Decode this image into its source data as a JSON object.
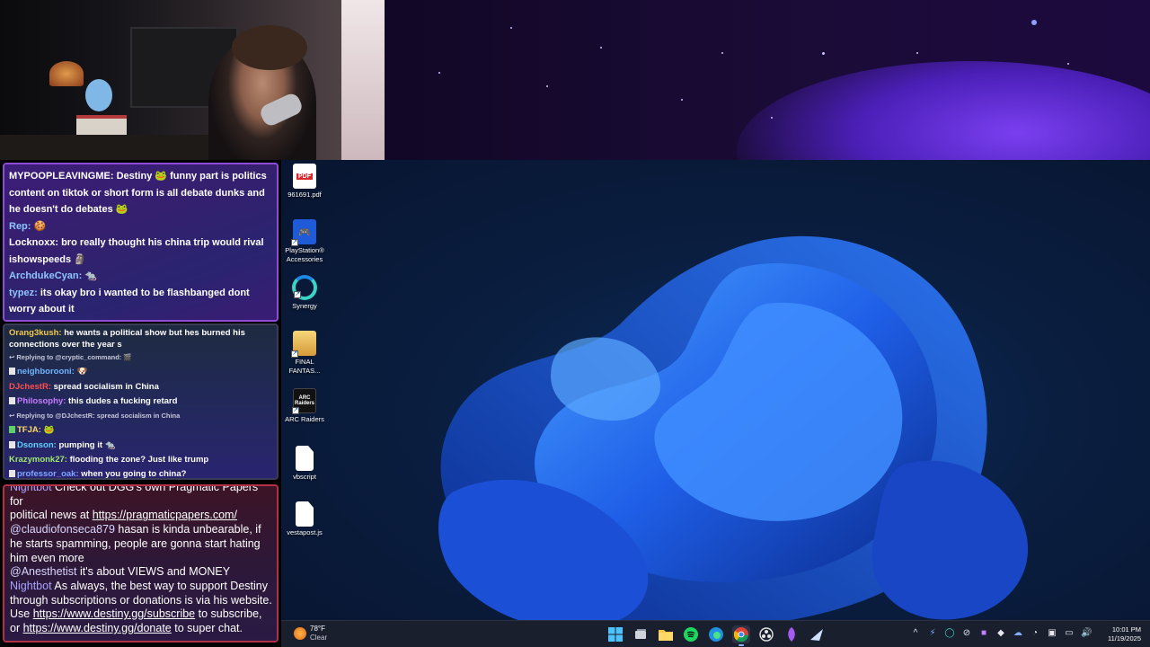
{
  "chat_top": {
    "messages": [
      {
        "user": "MYPOOPLEAVINGME:",
        "text": "Destiny 🐸 funny part is politics content on tiktok or short form is all debate dunks and he doesn't do debates 🐸"
      },
      {
        "user": "Rep:",
        "text": "🍪"
      },
      {
        "user": "Locknoxx:",
        "text": "bro really thought his china trip would rival ishowspeeds 🗿"
      },
      {
        "user": "ArchdukeCyan:",
        "text": "🐀"
      },
      {
        "user": "typez:",
        "text": "its okay bro i wanted to be flashbanged dont worry about it"
      }
    ]
  },
  "chat_mid": {
    "messages": [
      {
        "kind": "msg",
        "user": "Orang3kush:",
        "text": "he wants a political show but hes burned his connections over the year s",
        "color": "#f2c94c"
      },
      {
        "kind": "reply",
        "text": "↩ Replying to @cryptic_command: 🎬"
      },
      {
        "kind": "msg",
        "user": "neighborooni:",
        "text": "🐶",
        "color": "#6fb6ff"
      },
      {
        "kind": "msg",
        "user": "DJchestR:",
        "text": "spread socialism in China",
        "color": "#ff4d4d"
      },
      {
        "kind": "msg",
        "user": "Philosophy:",
        "text": "this dudes a fucking retard",
        "color": "#c77dff"
      },
      {
        "kind": "reply",
        "text": "↩ Replying to @DJchestR: spread socialism in China"
      },
      {
        "kind": "msg",
        "user": "TFJA:",
        "text": "🐸",
        "color": "#ffd966"
      },
      {
        "kind": "msg",
        "user": "Dsonson:",
        "text": "pumping it 🐀",
        "color": "#5fd0ff"
      },
      {
        "kind": "msg",
        "user": "Krazymonk27:",
        "text": "flooding the zone? Just like trump",
        "color": "#9fe870"
      },
      {
        "kind": "msg",
        "user": "professor_oak:",
        "text": "when you going to china?",
        "color": "#7ea6ff"
      }
    ]
  },
  "chat_bottom": {
    "nb1_partial": "Nightbot",
    "nb1_partial_text": "Check out DGG's own Pragmatic Papers for",
    "nb1_text": "political news at",
    "nb1_link": "https://pragmaticpapers.com/",
    "msg2_user": "@claudiofonseca879",
    "msg2_text": "hasan is kinda unbearable, if he starts spamming, people are gonna start hating him even more",
    "msg3_user": "@Anesthetist",
    "msg3_text": "it's about VIEWS and MONEY",
    "nb2_user": "Nightbot",
    "nb2_text": "As always, the best way to support Destiny through subscriptions or donations is via his website. Use",
    "nb2_link1": "https://www.destiny.gg/subscribe",
    "nb2_mid": "to subscribe, or",
    "nb2_link2": "https://www.destiny.gg/donate",
    "nb2_end": "to super chat."
  },
  "desktop_icons": [
    {
      "label": "961691.pdf",
      "icon": "pdf-icon"
    },
    {
      "label": "PlayStation® Accessories",
      "icon": "playstation-icon"
    },
    {
      "label": "Synergy",
      "icon": "synergy-icon"
    },
    {
      "label": "FINAL FANTAS...",
      "icon": "final-fantasy-icon"
    },
    {
      "label": "ARC Raiders",
      "icon": "arc-raiders-icon"
    },
    {
      "label": "vbscript",
      "icon": "file-icon"
    },
    {
      "label": "vestapost.js",
      "icon": "file-icon"
    }
  ],
  "weather": {
    "temp": "78°F",
    "condition": "Clear"
  },
  "clock": {
    "time": "10:01 PM",
    "date": "11/19/2025"
  },
  "accent": "#8e4bd6"
}
